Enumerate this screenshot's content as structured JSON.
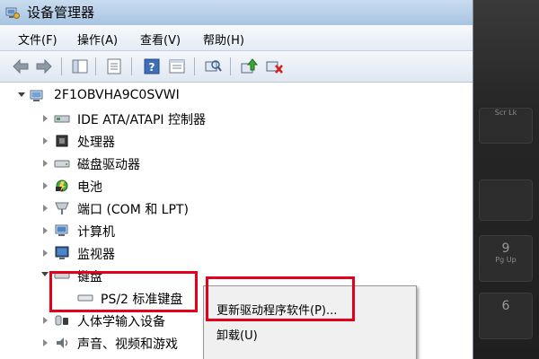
{
  "window": {
    "title": "设备管理器",
    "icon": "device-manager-icon"
  },
  "menu": [
    {
      "label": "文件(F)"
    },
    {
      "label": "操作(A)"
    },
    {
      "label": "查看(V)"
    },
    {
      "label": "帮助(H)"
    }
  ],
  "toolbar": {
    "buttons": [
      "back-arrow-icon",
      "forward-arrow-icon",
      "show-hide-tree-icon",
      "properties-icon",
      "help-icon",
      "console-icon",
      "scan-hardware-icon",
      "update-driver-icon",
      "uninstall-device-icon"
    ]
  },
  "tree": {
    "root": "2F1OBVHA9C0SVWI",
    "items": [
      {
        "label": "IDE ATA/ATAPI 控制器",
        "icon": "ide-controller-icon",
        "expanded": false
      },
      {
        "label": "处理器",
        "icon": "processor-icon",
        "expanded": false
      },
      {
        "label": "磁盘驱动器",
        "icon": "disk-drive-icon",
        "expanded": false
      },
      {
        "label": "电池",
        "icon": "battery-icon",
        "expanded": false
      },
      {
        "label": "端口 (COM 和 LPT)",
        "icon": "port-icon",
        "expanded": false
      },
      {
        "label": "计算机",
        "icon": "computer-icon",
        "expanded": false
      },
      {
        "label": "监视器",
        "icon": "monitor-icon",
        "expanded": false
      },
      {
        "label": "键盘",
        "icon": "keyboard-icon",
        "expanded": true
      },
      {
        "label": "PS/2 标准键盘",
        "icon": "keyboard-device-icon",
        "child": true
      },
      {
        "label": "人体学输入设备",
        "icon": "hid-icon",
        "expanded": false
      },
      {
        "label": "声音、视频和游戏",
        "icon": "sound-icon",
        "expanded": false
      }
    ]
  },
  "context_menu": {
    "items": [
      {
        "label": "更新驱动程序软件(P)..."
      },
      {
        "label": "卸载(U)"
      }
    ]
  },
  "colors": {
    "highlight_box": "#e2001a",
    "title_bar": "#b9d1ea"
  },
  "keyboard_background": {
    "keys": [
      {
        "top": "Scr Lk",
        "main": ""
      },
      {
        "top": "",
        "main": "9"
      },
      {
        "top": "Pg Up",
        "main": ""
      },
      {
        "top": "",
        "main": "6"
      }
    ]
  }
}
